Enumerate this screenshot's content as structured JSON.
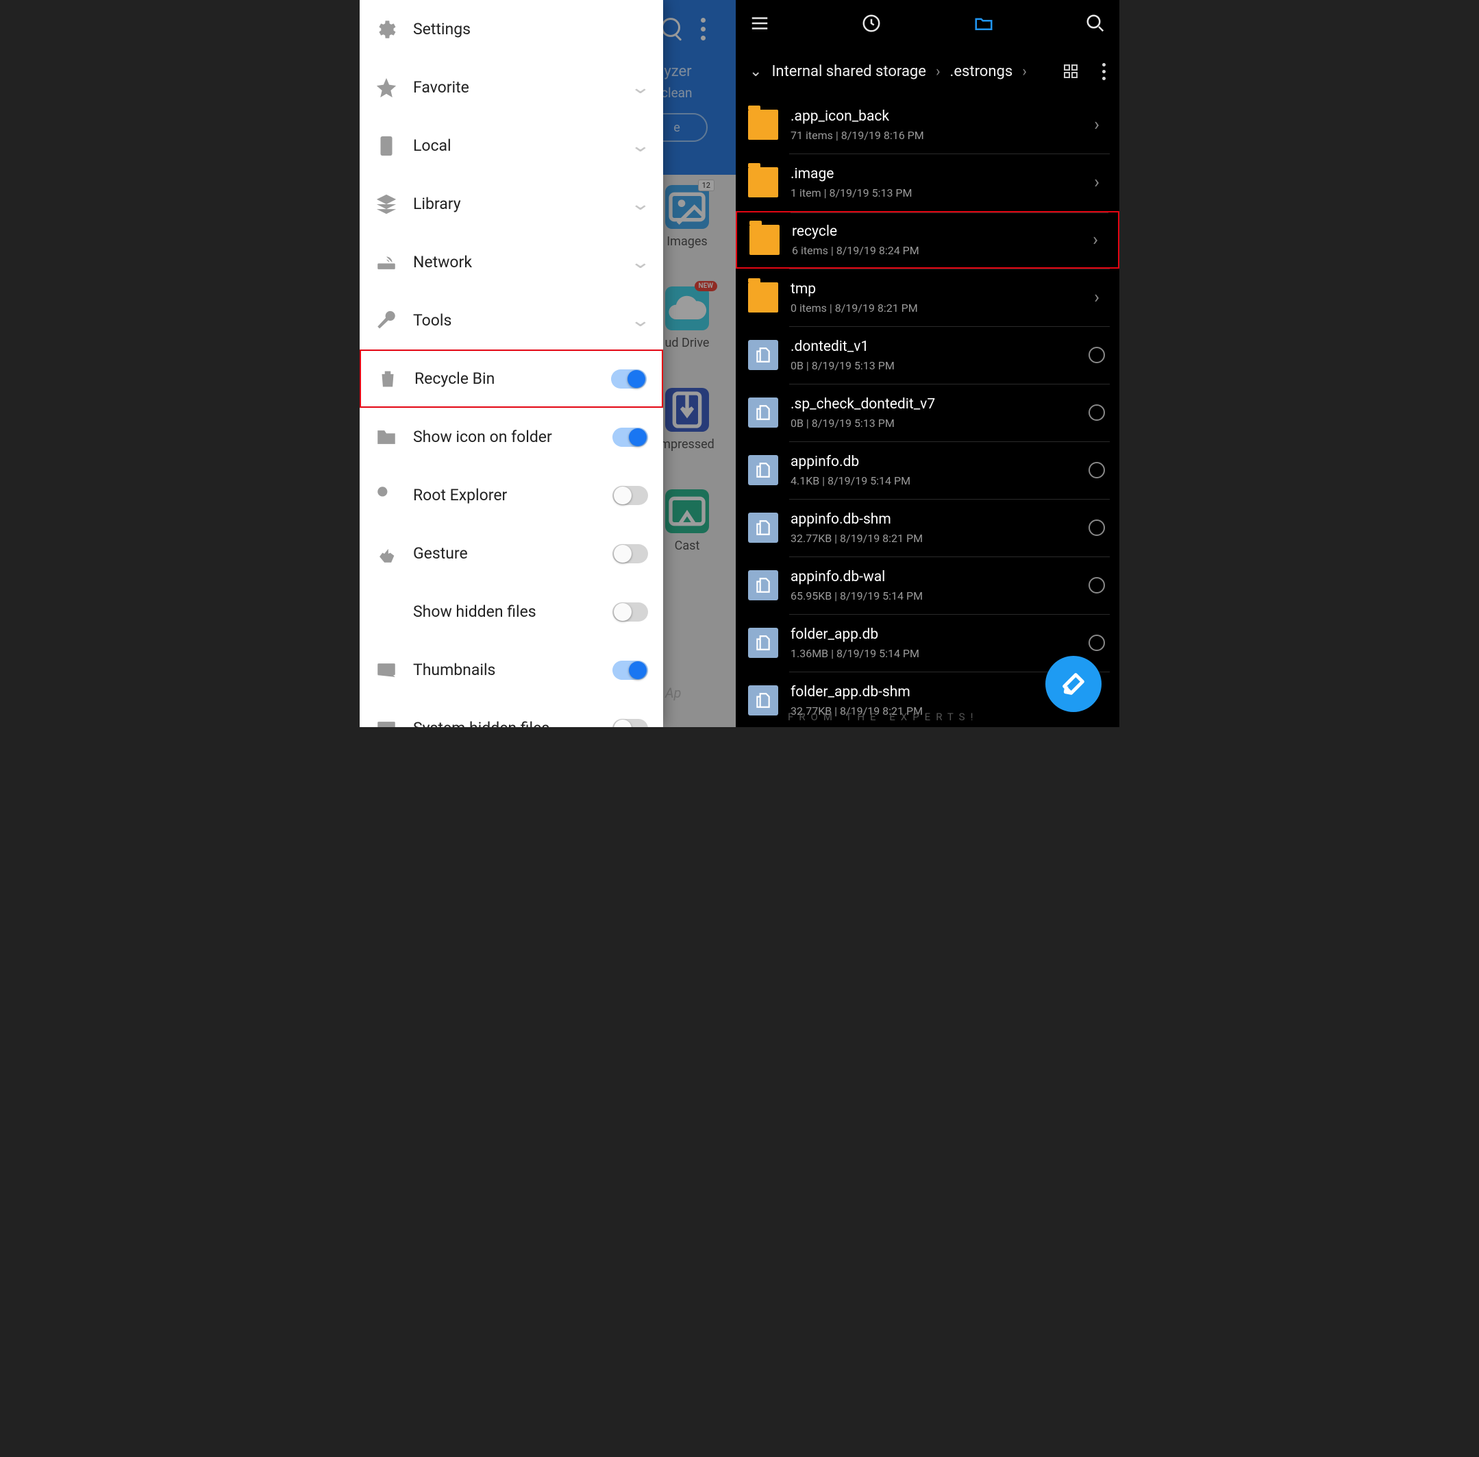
{
  "left": {
    "bg": {
      "analyzer_line1": "lyzer",
      "analyzer_line2": " clean",
      "analyze_btn": "e",
      "grid": [
        {
          "label": "Images",
          "color": "c1",
          "icon": "image",
          "count": "12"
        },
        {
          "label": "ud Drive",
          "color": "c2",
          "icon": "cloud",
          "new": "NEW"
        },
        {
          "label": "mpressed",
          "color": "c3",
          "icon": "zip"
        },
        {
          "label": "Cast",
          "color": "c4",
          "icon": "cast"
        }
      ],
      "wm": "Ap"
    },
    "drawer": [
      {
        "icon": "gear",
        "label": "Settings",
        "tail": "none"
      },
      {
        "icon": "star",
        "label": "Favorite",
        "tail": "chev"
      },
      {
        "icon": "phone",
        "label": "Local",
        "tail": "chev"
      },
      {
        "icon": "layers",
        "label": "Library",
        "tail": "chev"
      },
      {
        "icon": "router",
        "label": "Network",
        "tail": "chev"
      },
      {
        "icon": "wrench",
        "label": "Tools",
        "tail": "chev"
      },
      {
        "icon": "trash",
        "label": "Recycle Bin",
        "tail": "toggle",
        "on": true,
        "hl": true
      },
      {
        "icon": "folder-corner",
        "label": "Show icon on folder",
        "tail": "toggle",
        "on": true
      },
      {
        "icon": "key",
        "label": "Root Explorer",
        "tail": "toggle",
        "on": false
      },
      {
        "icon": "tap",
        "label": "Gesture",
        "tail": "toggle",
        "on": false
      },
      {
        "icon": "lines-x",
        "label": "Show hidden files",
        "tail": "toggle",
        "on": false
      },
      {
        "icon": "thumb",
        "label": "Thumbnails",
        "tail": "toggle",
        "on": true
      },
      {
        "icon": "sys",
        "label": "System hidden files",
        "tail": "toggle",
        "on": false
      }
    ]
  },
  "right": {
    "breadcrumbs": [
      "Internal shared storage",
      ".estrongs"
    ],
    "rows": [
      {
        "name": ".app_icon_back",
        "meta": "71 items  |  8/19/19 8:16 PM",
        "type": "folder",
        "tail": "nav"
      },
      {
        "name": ".image",
        "meta": "1 item  |  8/19/19 5:13 PM",
        "type": "folder",
        "tail": "nav"
      },
      {
        "name": "recycle",
        "meta": "6 items  |  8/19/19 8:24 PM",
        "type": "folder",
        "tail": "nav",
        "hl": true
      },
      {
        "name": "tmp",
        "meta": "0 items  |  8/19/19 8:21 PM",
        "type": "folder",
        "tail": "nav"
      },
      {
        "name": ".dontedit_v1",
        "meta": "0B  |  8/19/19 5:13 PM",
        "type": "file",
        "tail": "radio"
      },
      {
        "name": ".sp_check_dontedit_v7",
        "meta": "0B  |  8/19/19 5:13 PM",
        "type": "file",
        "tail": "radio"
      },
      {
        "name": "appinfo.db",
        "meta": "4.1KB  |  8/19/19 5:14 PM",
        "type": "file",
        "tail": "radio"
      },
      {
        "name": "appinfo.db-shm",
        "meta": "32.77KB  |  8/19/19 8:21 PM",
        "type": "file",
        "tail": "radio"
      },
      {
        "name": "appinfo.db-wal",
        "meta": "65.95KB  |  8/19/19 5:14 PM",
        "type": "file",
        "tail": "radio"
      },
      {
        "name": "folder_app.db",
        "meta": "1.36MB  |  8/19/19 5:14 PM",
        "type": "file",
        "tail": "radio"
      },
      {
        "name": "folder_app.db-shm",
        "meta": "32.77KB  |  8/19/19 8:21 PM",
        "type": "app",
        "tail": "none"
      }
    ],
    "wm": "FROM THE EXPERTS!"
  }
}
